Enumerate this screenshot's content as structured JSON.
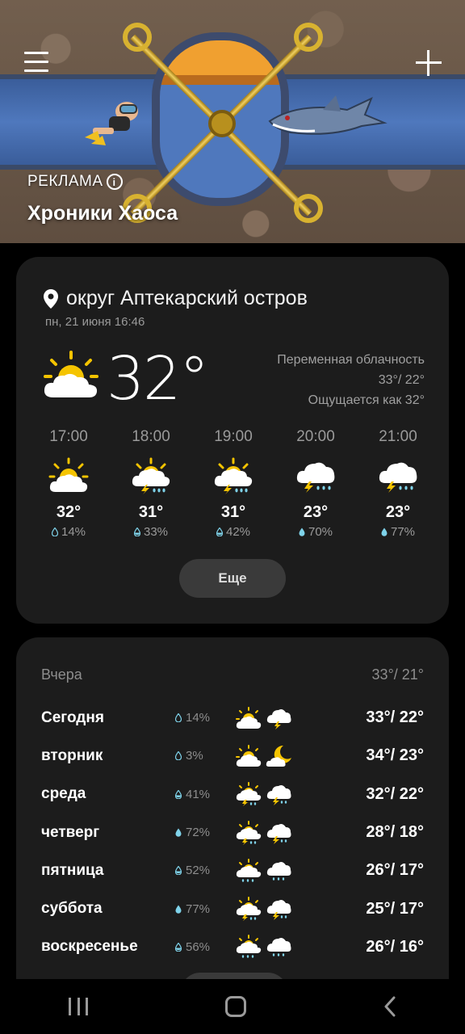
{
  "ad": {
    "label": "РЕКЛАМА",
    "title": "Хроники Хаоса"
  },
  "current": {
    "location": "округ Аптекарский остров",
    "datetime": "пн, 21 июня 16:46",
    "temperature": "32°",
    "condition": "Переменная облачность",
    "high_low": "33°/ 22°",
    "feels_like": "Ощущается как 32°",
    "icon": "partly-cloudy-sun-icon"
  },
  "hourly": [
    {
      "time": "17:00",
      "temp": "32°",
      "precip": "14%",
      "icon": "partly-cloudy-sun-icon"
    },
    {
      "time": "18:00",
      "temp": "31°",
      "precip": "33%",
      "icon": "sun-thunder-rain-icon"
    },
    {
      "time": "19:00",
      "temp": "31°",
      "precip": "42%",
      "icon": "sun-thunder-rain-icon"
    },
    {
      "time": "20:00",
      "temp": "23°",
      "precip": "70%",
      "icon": "thunder-rain-cloud-icon"
    },
    {
      "time": "21:00",
      "temp": "23°",
      "precip": "77%",
      "icon": "thunder-rain-cloud-icon"
    }
  ],
  "more_label": "Еще",
  "forecast": {
    "yesterday_label": "Вчера",
    "yesterday_range": "33°/ 21°",
    "days": [
      {
        "day": "Сегодня",
        "precip": "14%",
        "day_icon": "partly-cloudy-sun-icon",
        "night_icon": "thunder-cloud-icon",
        "range": "33°/ 22°"
      },
      {
        "day": "вторник",
        "precip": "3%",
        "day_icon": "partly-cloudy-sun-icon",
        "night_icon": "moon-cloud-icon",
        "range": "34°/ 23°"
      },
      {
        "day": "среда",
        "precip": "41%",
        "day_icon": "sun-thunder-rain-icon",
        "night_icon": "thunder-rain-cloud-icon",
        "range": "32°/ 22°"
      },
      {
        "day": "четверг",
        "precip": "72%",
        "day_icon": "sun-thunder-rain-icon",
        "night_icon": "thunder-rain-cloud-icon",
        "range": "28°/ 18°"
      },
      {
        "day": "пятница",
        "precip": "52%",
        "day_icon": "sun-rain-icon",
        "night_icon": "rain-cloud-icon",
        "range": "26°/ 17°"
      },
      {
        "day": "суббота",
        "precip": "77%",
        "day_icon": "sun-thunder-rain-icon",
        "night_icon": "thunder-rain-cloud-icon",
        "range": "25°/ 17°"
      },
      {
        "day": "воскресенье",
        "precip": "56%",
        "day_icon": "sun-rain-icon",
        "night_icon": "rain-cloud-icon",
        "range": "26°/ 16°"
      }
    ]
  },
  "colors": {
    "background": "#000000",
    "card": "#1c1c1c",
    "sun": "#f5c400",
    "cloud": "#ffffff",
    "drop": "#7fd3ea",
    "muted_text": "#9a9a9a"
  }
}
